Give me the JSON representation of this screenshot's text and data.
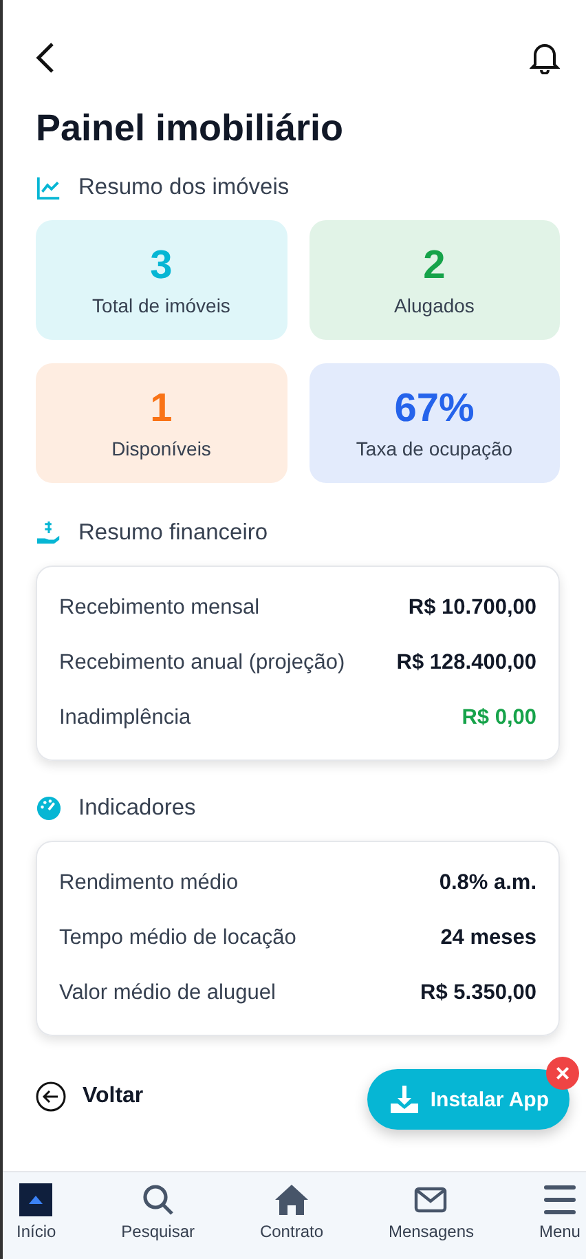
{
  "title": "Painel imobiliário",
  "sections": [
    {
      "kind": "stats",
      "heading": "Resumo dos imóveis",
      "stats": [
        {
          "value": "3",
          "label": "Total de imóveis",
          "color": "#06b6d4"
        },
        {
          "value": "2",
          "label": "Alugados",
          "color": "#16a34a"
        },
        {
          "value": "1",
          "label": "Disponíveis",
          "color": "#f97316"
        },
        {
          "value": "67%",
          "label": "Taxa de ocupação",
          "color": "#2563eb"
        }
      ]
    },
    {
      "kind": "finance",
      "heading": "Resumo financeiro",
      "rows": [
        {
          "label": "Recebimento mensal",
          "value": "R$ 10.700,00",
          "color": "#111827"
        },
        {
          "label": "Recebimento anual (projeção)",
          "value": "R$ 128.400,00",
          "color": "#111827"
        },
        {
          "label": "Inadimplência",
          "value": "R$ 0,00",
          "color": "#16a34a"
        }
      ]
    },
    {
      "kind": "indicators",
      "heading": "Indicadores",
      "rows": [
        {
          "label": "Rendimento médio",
          "value": "0.8% a.m.",
          "color": "#111827"
        },
        {
          "label": "Tempo médio de locação",
          "value": "24 meses",
          "color": "#111827"
        },
        {
          "label": "Valor médio de aluguel",
          "value": "R$ 5.350,00",
          "color": "#111827"
        }
      ]
    }
  ],
  "back_link": "Voltar",
  "install_button": "Instalar App",
  "close_badge": "×",
  "nav": [
    {
      "kind": "home",
      "label": "Início"
    },
    {
      "kind": "search",
      "label": "Pesquisar"
    },
    {
      "kind": "contract",
      "label": "Contrato"
    },
    {
      "kind": "messages",
      "label": "Mensagens"
    },
    {
      "kind": "menu",
      "label": "Menu"
    }
  ]
}
